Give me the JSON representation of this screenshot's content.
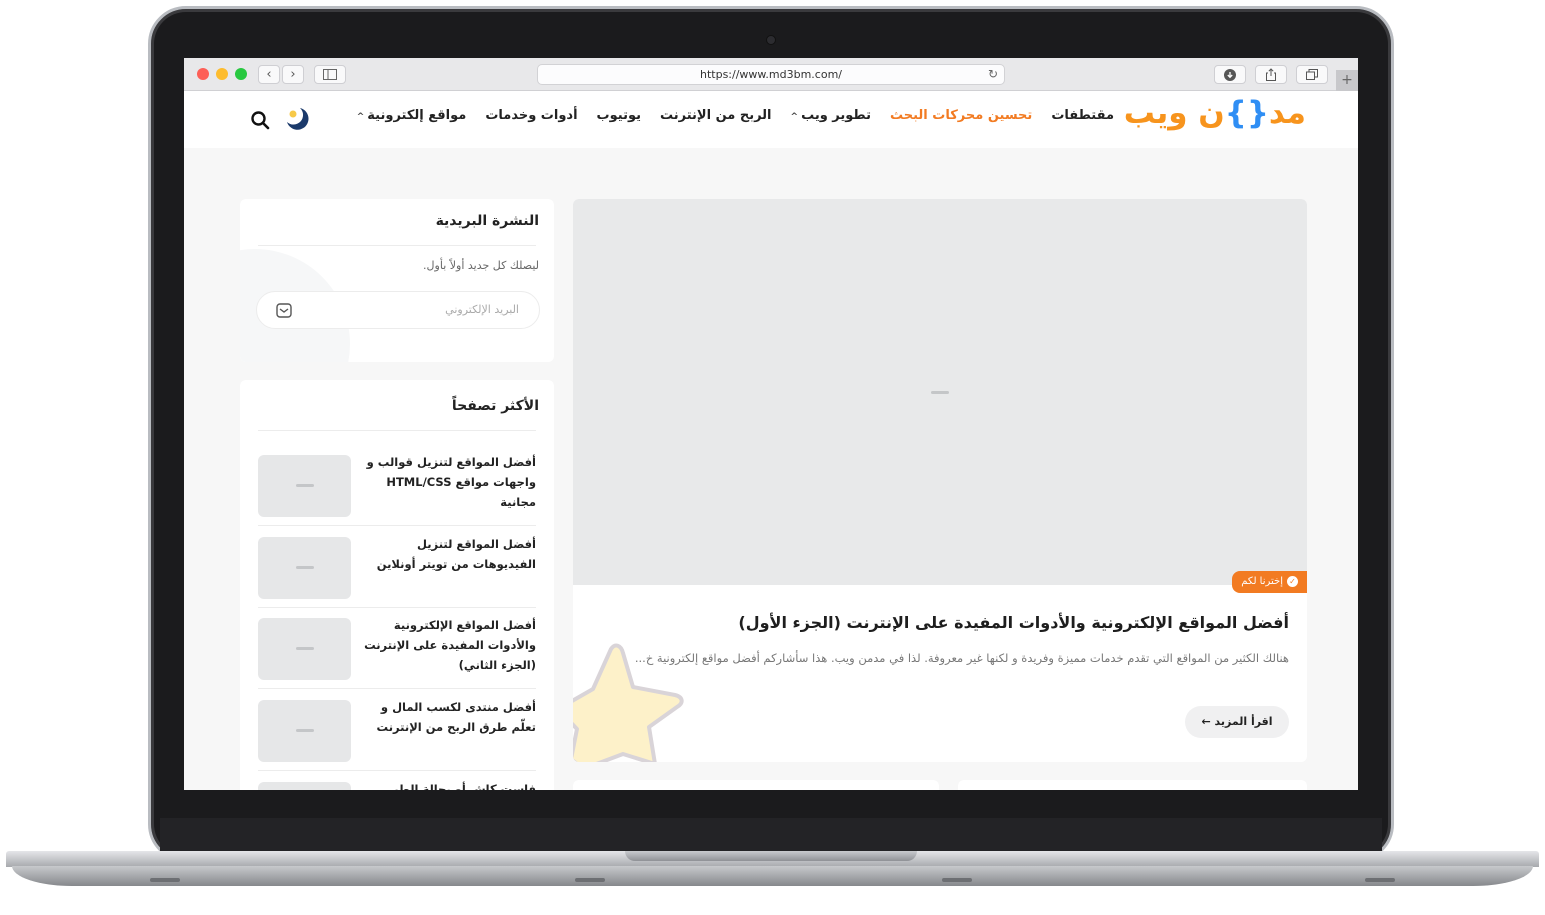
{
  "browser": {
    "url": "https://www.md3bm.com/"
  },
  "site": {
    "logo_main": "مد",
    "logo_bracket": "{}",
    "logo_rest": "ن ويب",
    "nav": [
      {
        "label": "مواقع إلكترونية",
        "has_dropdown": true
      },
      {
        "label": "أدوات وخدمات",
        "has_dropdown": false
      },
      {
        "label": "يوتيوب",
        "has_dropdown": false
      },
      {
        "label": "الربح من الإنترنت",
        "has_dropdown": false
      },
      {
        "label": "تطوير ويب",
        "has_dropdown": true
      },
      {
        "label": "تحسين محركات البحث",
        "has_dropdown": false,
        "active": true
      },
      {
        "label": "مقتطفات",
        "has_dropdown": false
      }
    ],
    "accent_color": "#f27b22"
  },
  "feature": {
    "badge": "إخترنا لكم",
    "title": "أفضل المواقع الإلكترونية والأدوات المفيدة على الإنترنت (الجزء الأول)",
    "excerpt": "هنالك الكثير من المواقع التي تقدم خدمات مميزة وفريدة و لكنها غير معروفة. لذا في مدمن ويب. هذا سأشاركم أفضل مواقع إلكترونية خ...",
    "read_more": "اقرأ المزيد"
  },
  "newsletter": {
    "title": "النشرة البريدية",
    "text": "ليصلك كل جديد أولاً بأول.",
    "email_placeholder": "البريد الإلكتروني"
  },
  "popular": {
    "title": "الأكثر تصفحاً",
    "items": [
      "أفضل المواقع لتنزيل قوالب و واجهات مواقع HTML/CSS مجانية",
      "أفضل المواقع لتنزيل الفيديوهات من تويتر أونلاين",
      "أفضل المواقع الإلكترونية والأدوات المفيدة على الإنترنت (الجزء الثاني)",
      "أفضل منتدى لكسب المال و تعلّم طرق الربح من الإنترنت",
      "فاست كاش أو بحالة الطير"
    ]
  }
}
